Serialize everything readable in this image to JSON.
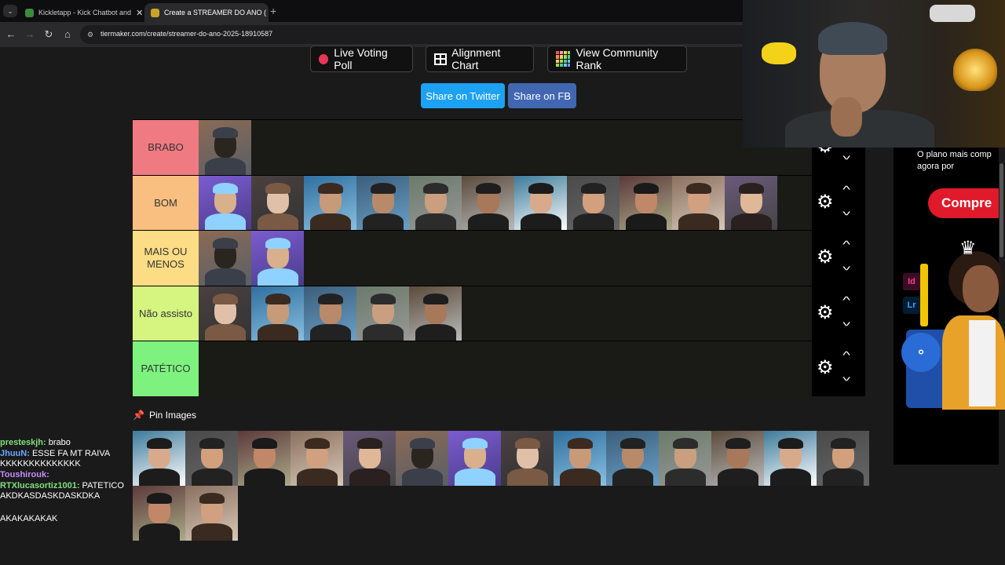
{
  "browser": {
    "tabs": [
      {
        "label": "Kickletapp - Kick Chatbot and",
        "active": false
      },
      {
        "label": "Create a STREAMER DO ANO (",
        "active": true
      }
    ],
    "url": "tiermaker.com/create/streamer-do-ano-2025-18910587"
  },
  "toolbar": {
    "live_voting": "Live Voting Poll",
    "alignment_chart": "Alignment Chart",
    "community_rank": "View Community Rank",
    "share_twitter": "Share on Twitter",
    "share_fb": "Share on FB"
  },
  "tiers": [
    {
      "label": "BRABO",
      "color": "#f07a81",
      "count": 1
    },
    {
      "label": "BOM",
      "color": "#f8bf80",
      "count": 11
    },
    {
      "label": "MAIS OU MENOS",
      "color": "#fcdc84",
      "count": 2
    },
    {
      "label": "Não assisto",
      "color": "#d5f480",
      "count": 5
    },
    {
      "label": "PATÉTICO",
      "color": "#7ef27e",
      "count": 0
    }
  ],
  "pin_images": {
    "title": "Pin Images",
    "row1_count": 14,
    "row2_count": 2
  },
  "chat": [
    {
      "user": "presteskjh:",
      "user_color": "#7fe07f",
      "text": "brabo"
    },
    {
      "user": "JhuuN:",
      "user_color": "#6ba8ff",
      "text": "ESSE FA MT RAIVA KKKKKKKKKKKKKK"
    },
    {
      "user": "Toushirouk:",
      "user_color": "#c58cff",
      "text": ""
    },
    {
      "user": "RTXlucasortiz1001:",
      "user_color": "#7fe07f",
      "text": "PATETICO AKDKASDASKDASKDKA"
    },
    {
      "user": "",
      "user_color": "#ffffff",
      "text": "AKAKAKAKAK"
    }
  ],
  "ad": {
    "headline": "O plano mais comp agora por",
    "button": "Compre",
    "badge_id": "Id",
    "badge_lr": "Lr"
  },
  "colors": {
    "twitter": "#1da1f2",
    "facebook": "#4267b2",
    "live_dot": "#e63757",
    "ad_button": "#e01a2a"
  }
}
